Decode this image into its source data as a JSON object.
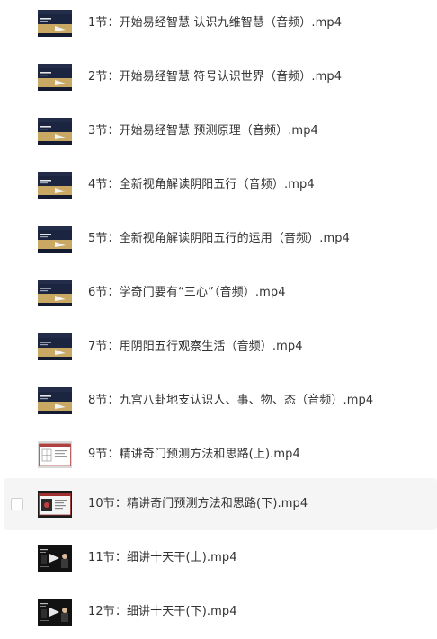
{
  "files": [
    {
      "name": "1节：开始易经智慧 认识九维智慧（音频）.mp4",
      "thumb": "audio-slide"
    },
    {
      "name": "2节：开始易经智慧 符号认识世界（音频）.mp4",
      "thumb": "audio-slide"
    },
    {
      "name": "3节：开始易经智慧 预测原理（音频）.mp4",
      "thumb": "audio-slide"
    },
    {
      "name": "4节：全新视角解读阴阳五行（音频）.mp4",
      "thumb": "audio-slide"
    },
    {
      "name": "5节：全新视角解读阴阳五行的运用（音频）.mp4",
      "thumb": "audio-slide"
    },
    {
      "name": "6节：学奇门要有“三心”（音频）.mp4",
      "thumb": "audio-slide"
    },
    {
      "name": "7节：用阴阳五行观察生活（音频）.mp4",
      "thumb": "audio-slide"
    },
    {
      "name": "8节：九宫八卦地支认识人、事、物、态（音频）.mp4",
      "thumb": "audio-slide"
    },
    {
      "name": "9节：精讲奇门预测方法和思路(上).mp4",
      "thumb": "chart-slide"
    },
    {
      "name": "10节：精讲奇门预测方法和思路(下).mp4",
      "thumb": "chart-slide-dark"
    },
    {
      "name": "11节：细讲十天干(上).mp4",
      "thumb": "lecture-dark"
    },
    {
      "name": "12节：细讲十天干(下).mp4",
      "thumb": "lecture-dark"
    }
  ],
  "hovered_index": 9,
  "colors": {
    "hover_bg": "#f5f5f6",
    "text": "#333333",
    "thumb_navy": "#1b2540",
    "thumb_gold": "#c8a862"
  }
}
